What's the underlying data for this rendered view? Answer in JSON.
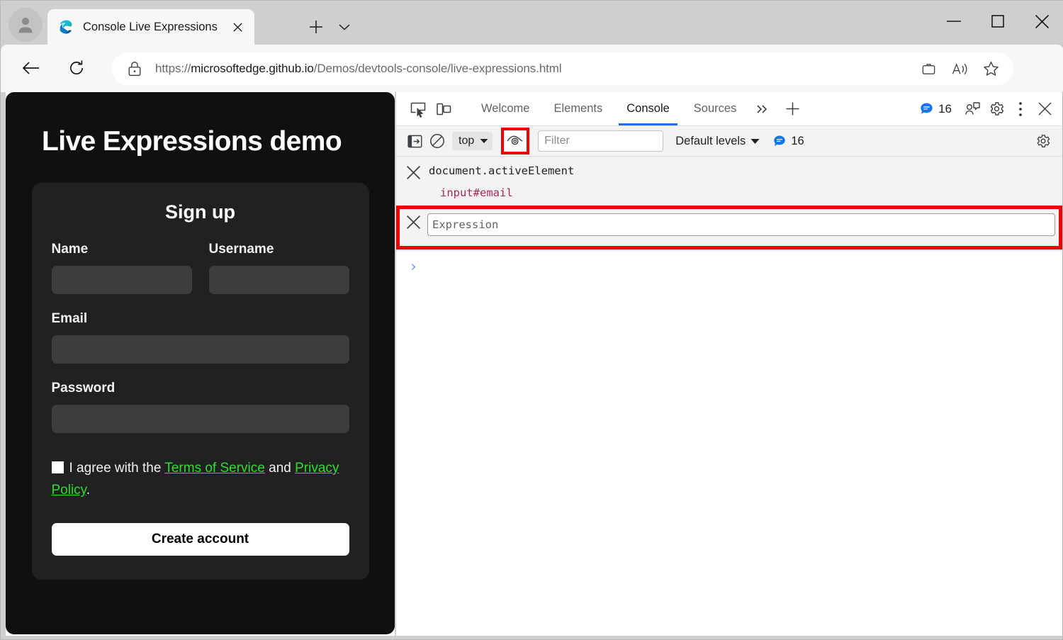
{
  "browser": {
    "tab": {
      "title": "Console Live Expressions",
      "favicon": "edge-logo-icon",
      "close_label": "×"
    },
    "new_tab_label": "+",
    "tab_dropdown_label": "v",
    "window_controls": {
      "minimize": "minimize-icon",
      "maximize": "maximize-icon",
      "close": "close-icon"
    },
    "address_bar": {
      "url_scheme": "https://",
      "url_domain": "microsoftedge.github.io",
      "url_path": "/Demos/devtools-console/live-expressions.html",
      "url_full": "https://microsoftedge.github.io/Demos/devtools-console/live-expressions.html",
      "lock_icon": "lock-icon",
      "back_icon": "back-arrow-icon",
      "reload_icon": "reload-icon",
      "collections_icon": "collections-icon",
      "read_aloud_icon": "read-aloud-icon",
      "favorites_icon": "star-icon",
      "settings_more_icon": "ellipsis-icon"
    }
  },
  "page": {
    "heading": "Live Expressions demo",
    "form": {
      "title": "Sign up",
      "fields": [
        {
          "label": "Name",
          "value": "",
          "name": "name"
        },
        {
          "label": "Username",
          "value": "",
          "name": "username"
        },
        {
          "label": "Email",
          "value": "",
          "name": "email"
        },
        {
          "label": "Password",
          "value": "",
          "name": "password"
        }
      ],
      "terms": {
        "checkbox_checked": false,
        "text_before": "I agree with the ",
        "link_tos": "Terms of Service",
        "text_middle": " and ",
        "link_privacy": "Privacy Policy",
        "text_after": ".",
        "link_color": "#2fdd2f"
      },
      "submit_label": "Create account"
    }
  },
  "devtools": {
    "tabbar": {
      "inspect_icon": "inspect-element-icon",
      "device_toolbar_icon": "device-emulation-icon",
      "tabs": [
        {
          "label": "Welcome",
          "active": false
        },
        {
          "label": "Elements",
          "active": false
        },
        {
          "label": "Console",
          "active": true
        },
        {
          "label": "Sources",
          "active": false
        }
      ],
      "more_tabs_label": "»",
      "add_tab_label": "+",
      "issues_count": "16",
      "feedback_icon": "feedback-icon",
      "settings_icon": "gear-icon",
      "more_icon": "kebab-menu-icon",
      "close_icon": "close-icon",
      "active_underline_color": "#1a73e8"
    },
    "console_toolbar": {
      "sidebar_icon": "console-sidebar-icon",
      "clear_icon": "clear-console-icon",
      "context_selected": "top",
      "live_expression_icon": "eye-icon",
      "live_expression_highlighted": true,
      "filter_placeholder": "Filter",
      "filter_value": "",
      "levels_label": "Default levels",
      "message_count": "16",
      "settings_icon": "gear-icon",
      "highlight_color": "#ee0000"
    },
    "console_body": {
      "live_expressions": [
        {
          "expression": "document.activeElement",
          "value": "input#email",
          "value_color": "#a62a54",
          "close_icon": "close-icon"
        }
      ],
      "new_expression": {
        "placeholder": "Expression",
        "value": "",
        "close_icon": "close-icon",
        "highlighted": true
      },
      "prompt_symbol": "›"
    }
  }
}
